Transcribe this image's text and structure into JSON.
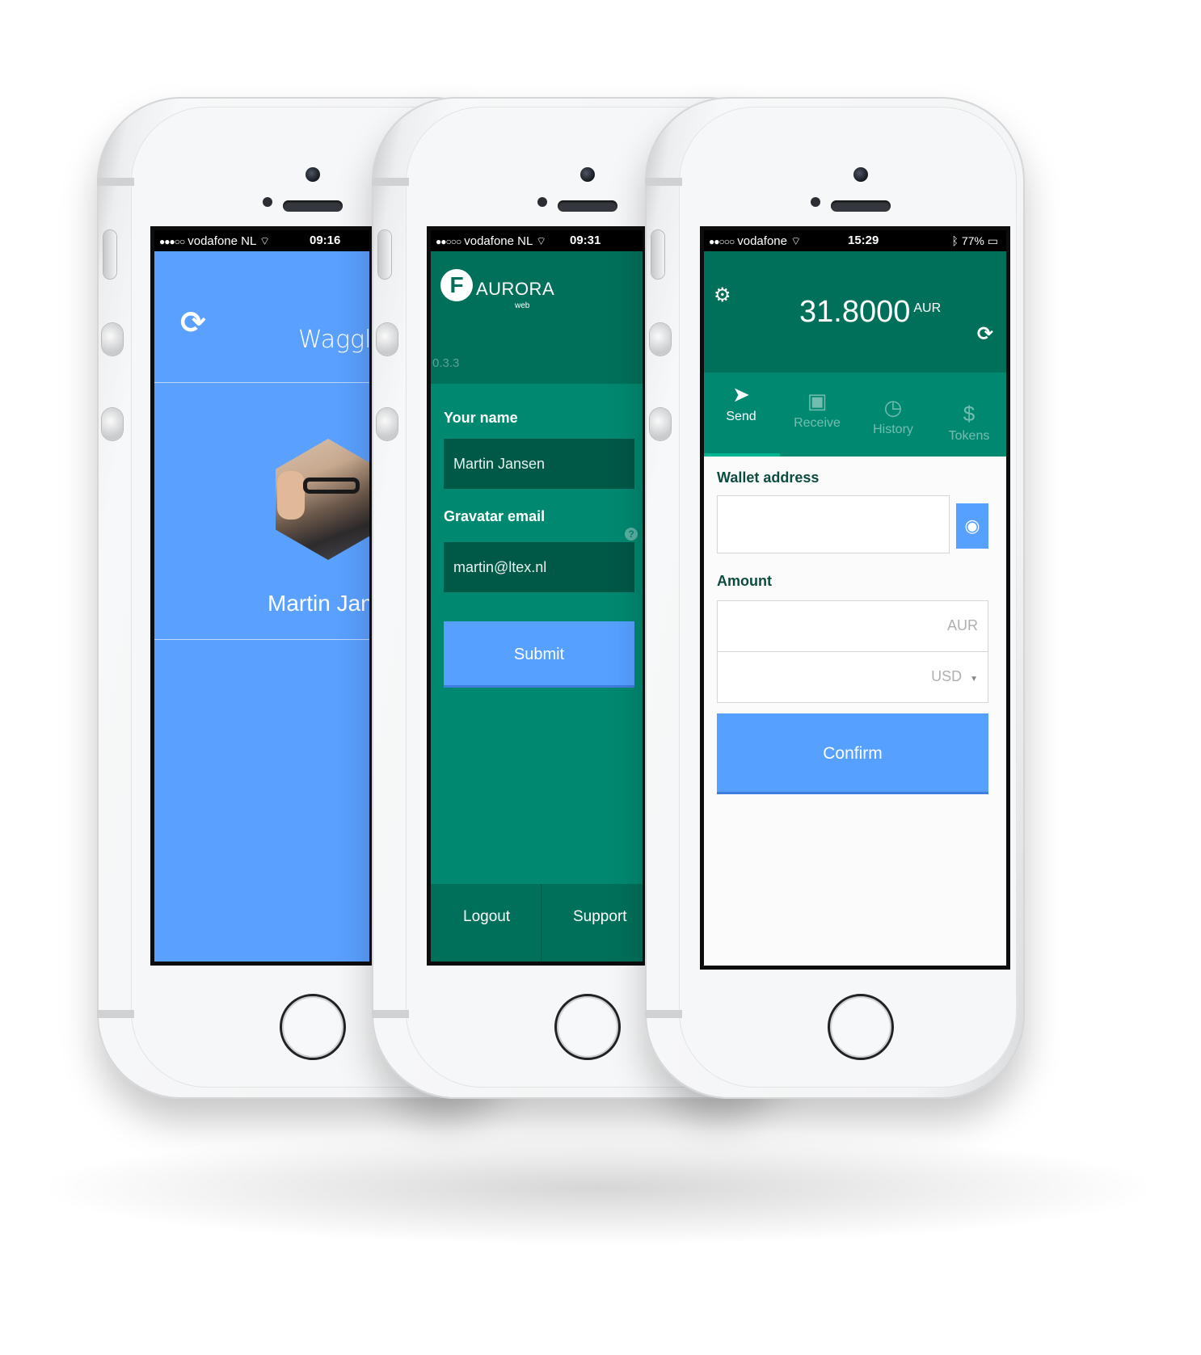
{
  "phone1": {
    "status": {
      "carrier": "vodafone NL",
      "time": "09:16"
    },
    "refresh_icon": "refresh-icon",
    "title": "Waggle",
    "profile_name": "Martin Jansen"
  },
  "phone2": {
    "status": {
      "carrier": "vodafone NL",
      "time": "09:31"
    },
    "logo": {
      "mark": "F",
      "name": "AURORA",
      "sub": "web"
    },
    "version": "0.3.3",
    "name_label": "Your name",
    "name_value": "Martin Jansen",
    "email_label": "Gravatar email",
    "email_value": "martin@ltex.nl",
    "help_icon": "?",
    "submit_label": "Submit",
    "footer": {
      "logout": "Logout",
      "support": "Support"
    }
  },
  "phone3": {
    "status": {
      "carrier": "vodafone",
      "time": "15:29",
      "battery": "77%"
    },
    "balance": "31.8000",
    "balance_unit": "AUR",
    "tabs": [
      {
        "label": "Send",
        "icon": "send-icon"
      },
      {
        "label": "Receive",
        "icon": "inbox-icon"
      },
      {
        "label": "History",
        "icon": "clock-icon"
      },
      {
        "label": "Tokens",
        "icon": "dollar-icon"
      }
    ],
    "wallet_label": "Wallet address",
    "amount_label": "Amount",
    "currency_primary": "AUR",
    "currency_secondary": "USD",
    "confirm_label": "Confirm"
  }
}
